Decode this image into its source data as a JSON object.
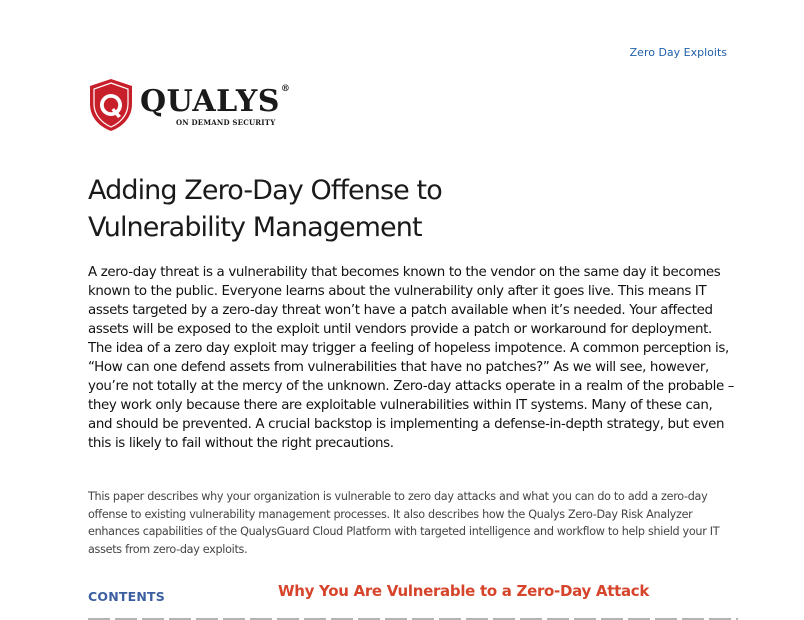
{
  "header": {
    "link_text": "Zero Day Exploits"
  },
  "logo": {
    "shield_letter": "Q",
    "wordmark": "QUALYS",
    "registered_mark": "®",
    "tagline": "ON DEMAND SECURITY",
    "colors": {
      "shield": "#c8202a",
      "ring": "#ffffff",
      "wordmark": "#1a1a1a"
    }
  },
  "title_line1": "Adding Zero-Day Offense to",
  "title_line2": "Vulnerability Management",
  "lead_paragraph": "A zero-day threat is a vulnerability that becomes known to the vendor on the same day it becomes known to the public. Everyone learns about the vulnerability only after it goes live. This means IT assets targeted by a zero-day threat won’t have a patch available when it’s needed. Your affected assets will be exposed to the exploit until vendors provide a patch or workaround for deployment. The idea of a zero day exploit may trigger a feeling of hopeless impotence. A common perception is, “How can one defend assets from vulnerabilities that have no patches?” As we will see, however, you’re not totally at the mercy of the unknown. Zero-day attacks operate in a realm of the probable – they work only because there are exploitable vulnerabilities within IT systems. Many of these can, and should be prevented. A crucial backstop is implementing a defense-in-depth strategy, but even this is likely to fail without the right precautions.",
  "summary_paragraph": "This paper describes why your organization is vulnerable to zero day attacks and what you can do to add a zero-day offense to existing vulnerability management processes. It also describes how the Qualys Zero-Day Risk Analyzer enhances capabilities of the QualysGuard Cloud Platform with targeted intelligence and workflow to help shield your IT assets from zero-day exploits.",
  "contents_label": "CONTENTS",
  "section_heading": "Why You Are Vulnerable to a Zero-Day Attack",
  "colors": {
    "link": "#1f5fa8",
    "contents": "#3b5fa0",
    "section_heading": "#d6452b"
  }
}
